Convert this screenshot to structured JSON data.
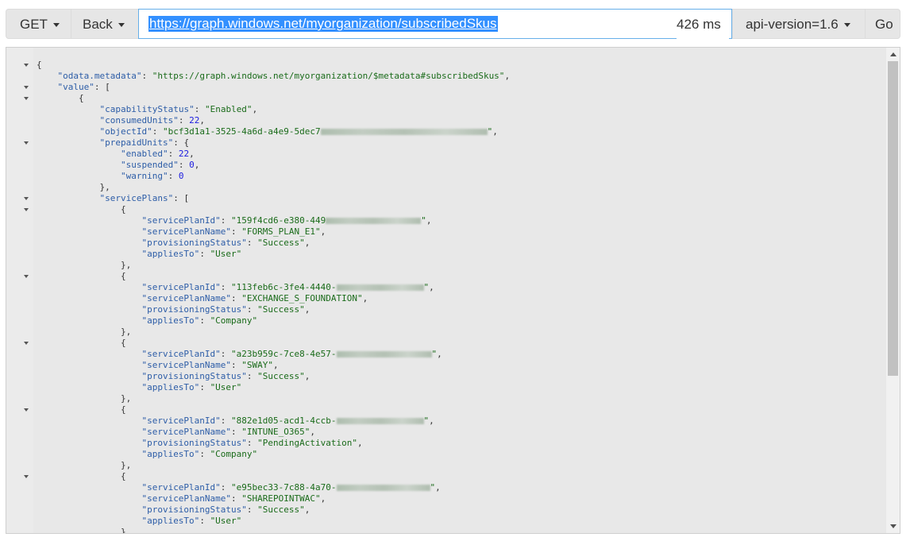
{
  "toolbar": {
    "method": "GET",
    "back": "Back",
    "url": "https://graph.windows.net/myorganization/subscribedSkus",
    "timing": "426 ms",
    "api_version": "api-version=1.6",
    "go": "Go"
  },
  "json_lines": [
    "{",
    "    \"odata.metadata\": \"https://graph.windows.net/myorganization/$metadata#subscribedSkus\",",
    "    \"value\": [",
    "        {",
    "            \"capabilityStatus\": \"Enabled\",",
    "            \"consumedUnits\": 22,",
    "            \"objectId\": \"bcf3d1a1-3525-4a6d-a4e9-5dec7",
    "            \"prepaidUnits\": {",
    "                \"enabled\": 22,",
    "                \"suspended\": 0,",
    "                \"warning\": 0",
    "            },",
    "            \"servicePlans\": [",
    "                {",
    "                    \"servicePlanId\": \"159f4cd6-e380-449",
    "                    \"servicePlanName\": \"FORMS_PLAN_E1\",",
    "                    \"provisioningStatus\": \"Success\",",
    "                    \"appliesTo\": \"User\"",
    "                },",
    "                {",
    "                    \"servicePlanId\": \"113feb6c-3fe4-4440-",
    "                    \"servicePlanName\": \"EXCHANGE_S_FOUNDATION\",",
    "                    \"provisioningStatus\": \"Success\",",
    "                    \"appliesTo\": \"Company\"",
    "                },",
    "                {",
    "                    \"servicePlanId\": \"a23b959c-7ce8-4e57-",
    "                    \"servicePlanName\": \"SWAY\",",
    "                    \"provisioningStatus\": \"Success\",",
    "                    \"appliesTo\": \"User\"",
    "                },",
    "                {",
    "                    \"servicePlanId\": \"882e1d05-acd1-4ccb-",
    "                    \"servicePlanName\": \"INTUNE_O365\",",
    "                    \"provisioningStatus\": \"PendingActivation\",",
    "                    \"appliesTo\": \"Company\"",
    "                },",
    "                {",
    "                    \"servicePlanId\": \"e95bec33-7c88-4a70-",
    "                    \"servicePlanName\": \"SHAREPOINTWAC\",",
    "                    \"provisioningStatus\": \"Success\",",
    "                    \"appliesTo\": \"User\"",
    "                },"
  ],
  "colors": {
    "key": "#2d5da7",
    "string": "#1a6b1a",
    "number": "#1b1be0",
    "url_highlight": "#3390ff"
  },
  "icons": [
    "caret-down-icon",
    "fold-arrow-icon",
    "scroll-up-icon",
    "scroll-down-icon"
  ]
}
